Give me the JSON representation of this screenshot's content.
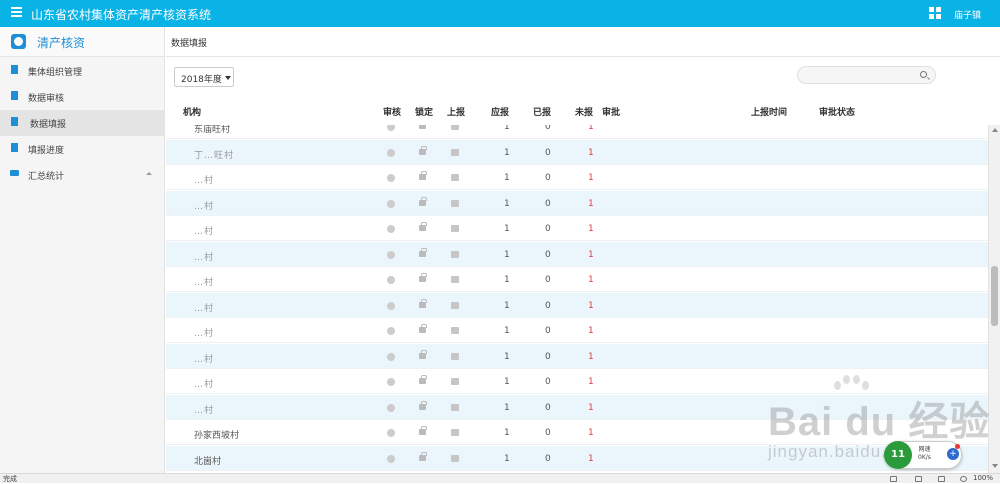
{
  "topbar": {
    "title": "山东省农村集体资产清产核资系统",
    "user": "庙子镇"
  },
  "sidebar": {
    "brand": "清产核资",
    "items": [
      {
        "label": "集体组织管理",
        "icon": "document-icon"
      },
      {
        "label": "数据审核",
        "icon": "document-icon"
      },
      {
        "label": "数据填报",
        "icon": "document-icon",
        "active": true
      },
      {
        "label": "填报进度",
        "icon": "document-icon"
      },
      {
        "label": "汇总统计",
        "icon": "folder-icon"
      }
    ]
  },
  "main": {
    "breadcrumb": "数据填报",
    "year_select": "2018年度",
    "search_placeholder": "",
    "columns": {
      "org": "机构",
      "review": "审核",
      "lock": "锁定",
      "report": "上报",
      "due": "应报",
      "done": "已报",
      "pending": "未报",
      "approve": "审批",
      "report_time": "上报时间",
      "approve_status": "审批状态"
    },
    "rows": [
      {
        "org": "东庙旺村",
        "due": "1",
        "done": "0",
        "pending": "1"
      },
      {
        "org": "丁…旺村",
        "due": "1",
        "done": "0",
        "pending": "1"
      },
      {
        "org": "…村",
        "due": "1",
        "done": "0",
        "pending": "1"
      },
      {
        "org": "…村",
        "due": "1",
        "done": "0",
        "pending": "1"
      },
      {
        "org": "…村",
        "due": "1",
        "done": "0",
        "pending": "1"
      },
      {
        "org": "…村",
        "due": "1",
        "done": "0",
        "pending": "1"
      },
      {
        "org": "…村",
        "due": "1",
        "done": "0",
        "pending": "1"
      },
      {
        "org": "…村",
        "due": "1",
        "done": "0",
        "pending": "1"
      },
      {
        "org": "…村",
        "due": "1",
        "done": "0",
        "pending": "1"
      },
      {
        "org": "…村",
        "due": "1",
        "done": "0",
        "pending": "1"
      },
      {
        "org": "…村",
        "due": "1",
        "done": "0",
        "pending": "1"
      },
      {
        "org": "…村",
        "due": "1",
        "done": "0",
        "pending": "1"
      },
      {
        "org": "孙家西坡村",
        "due": "1",
        "done": "0",
        "pending": "1"
      },
      {
        "org": "北崮村",
        "due": "1",
        "done": "0",
        "pending": "1"
      }
    ],
    "pending_color": "#e23a3a"
  },
  "statusbar": {
    "status": "完成",
    "zoom": "100%"
  },
  "watermark": {
    "brand": "Bai du 经验",
    "url": "jingyan.baidu.com"
  },
  "widget": {
    "ball": "11",
    "speed_label": "网速",
    "speed": "0K/s",
    "plus": "+"
  },
  "colors": {
    "topbar": "#0ab3e6",
    "accent": "#1e8fd6",
    "row_alt": "#eaf6fb"
  }
}
